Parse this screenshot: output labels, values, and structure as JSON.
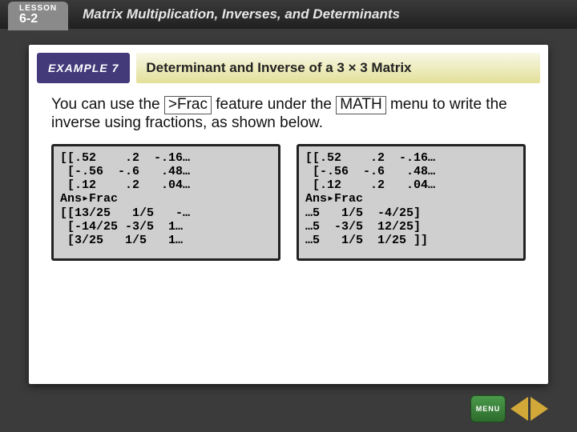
{
  "lesson": {
    "small": "LESSON",
    "number": "6-2"
  },
  "chapter_title": "Matrix Multiplication, Inverses, and Determinants",
  "example_label": "EXAMPLE 7",
  "slide_title": "Determinant and Inverse of a 3 × 3 Matrix",
  "body": {
    "pre": "You can use the",
    "key1": ">Frac",
    "mid": " feature under the ",
    "key2": "MATH",
    "post": " menu to write the inverse using fractions, as shown below."
  },
  "calc": {
    "left": "[[.52    .2  -.16…\n [-.56  -.6   .48…\n [.12    .2   .04…\nAns▸Frac\n[[13/25   1/5   -…\n [-14/25 -3/5  1…\n [3/25   1/5   1…",
    "right": "[[.52    .2  -.16…\n [-.56  -.6   .48…\n [.12    .2   .04…\nAns▸Frac\n…5   1/5  -4/25]\n…5  -3/5  12/25]\n…5   1/5  1/25 ]]"
  },
  "nav": {
    "menu": "MENU"
  }
}
